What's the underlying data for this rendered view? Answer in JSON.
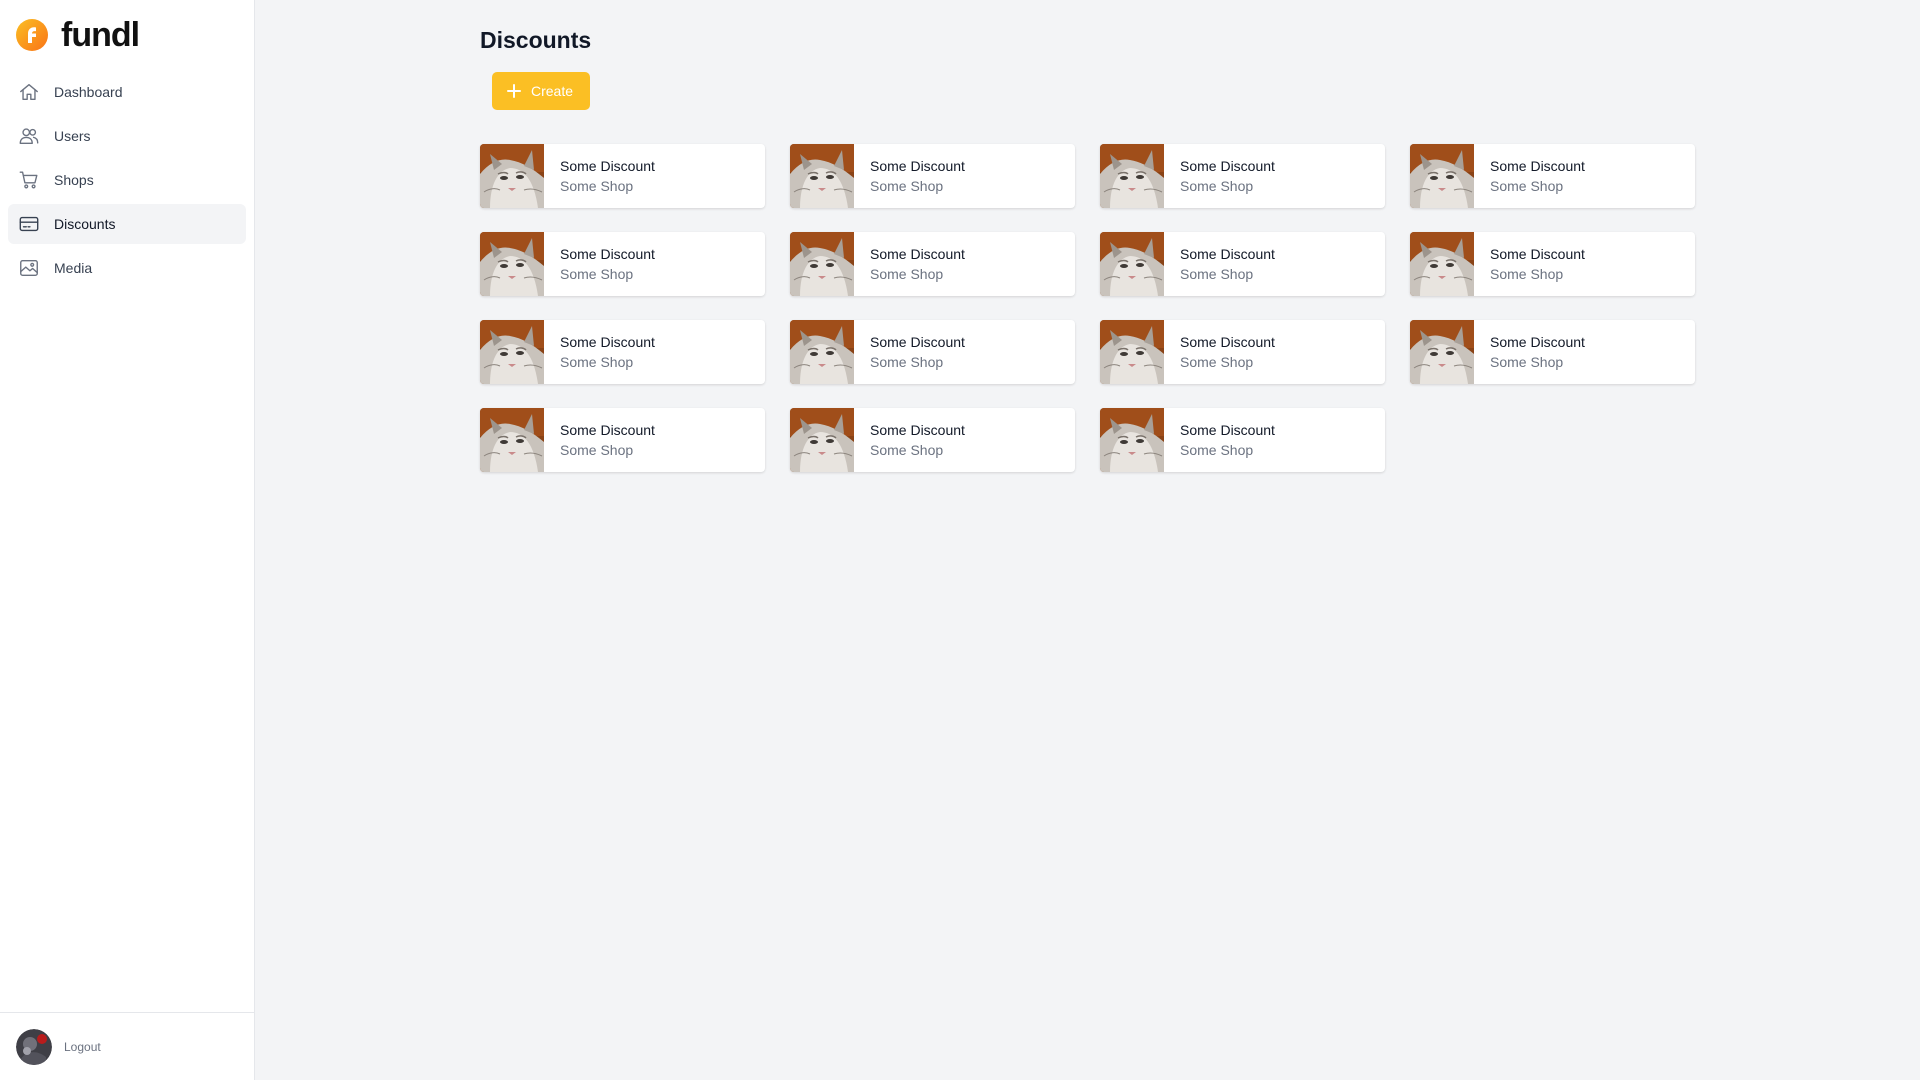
{
  "brand": {
    "name": "fundl",
    "accent": "#fb923c"
  },
  "nav": {
    "items": [
      {
        "label": "Dashboard",
        "icon": "home-icon",
        "active": false
      },
      {
        "label": "Users",
        "icon": "users-icon",
        "active": false
      },
      {
        "label": "Shops",
        "icon": "cart-icon",
        "active": false
      },
      {
        "label": "Discounts",
        "icon": "credit-card-icon",
        "active": true
      },
      {
        "label": "Media",
        "icon": "image-icon",
        "active": false
      }
    ]
  },
  "footer": {
    "logout_label": "Logout",
    "avatar_icon": "avatar"
  },
  "main": {
    "title": "Discounts",
    "create_label": "Create",
    "create_color": "#fbbf24",
    "cards": [
      {
        "title": "Some Discount",
        "shop": "Some Shop"
      },
      {
        "title": "Some Discount",
        "shop": "Some Shop"
      },
      {
        "title": "Some Discount",
        "shop": "Some Shop"
      },
      {
        "title": "Some Discount",
        "shop": "Some Shop"
      },
      {
        "title": "Some Discount",
        "shop": "Some Shop"
      },
      {
        "title": "Some Discount",
        "shop": "Some Shop"
      },
      {
        "title": "Some Discount",
        "shop": "Some Shop"
      },
      {
        "title": "Some Discount",
        "shop": "Some Shop"
      },
      {
        "title": "Some Discount",
        "shop": "Some Shop"
      },
      {
        "title": "Some Discount",
        "shop": "Some Shop"
      },
      {
        "title": "Some Discount",
        "shop": "Some Shop"
      },
      {
        "title": "Some Discount",
        "shop": "Some Shop"
      },
      {
        "title": "Some Discount",
        "shop": "Some Shop"
      },
      {
        "title": "Some Discount",
        "shop": "Some Shop"
      },
      {
        "title": "Some Discount",
        "shop": "Some Shop"
      }
    ]
  }
}
